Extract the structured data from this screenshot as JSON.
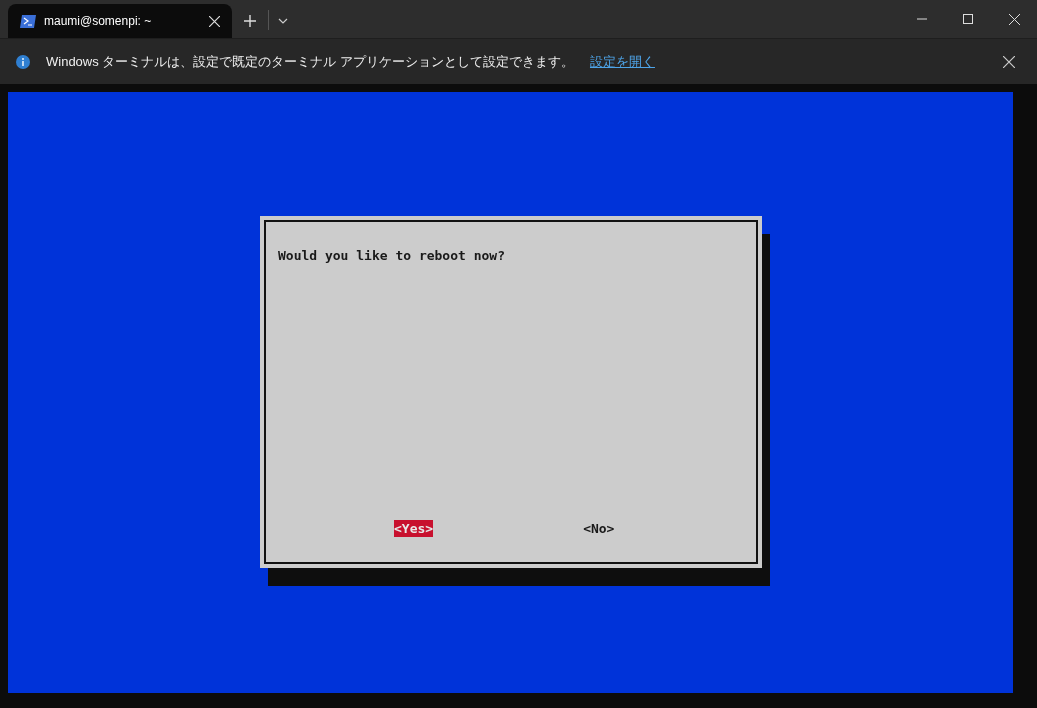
{
  "tabs": [
    {
      "title": "maumi@somenpi: ~",
      "selected": true
    }
  ],
  "infobar": {
    "message": "Windows ターミナルは、設定で既定のターミナル アプリケーションとして設定できます。",
    "link": "設定を開く"
  },
  "dialog": {
    "message": "Would you like to reboot now?",
    "buttons": [
      {
        "label": "<Yes>",
        "selected": true
      },
      {
        "label": "<No>",
        "selected": false
      }
    ]
  }
}
